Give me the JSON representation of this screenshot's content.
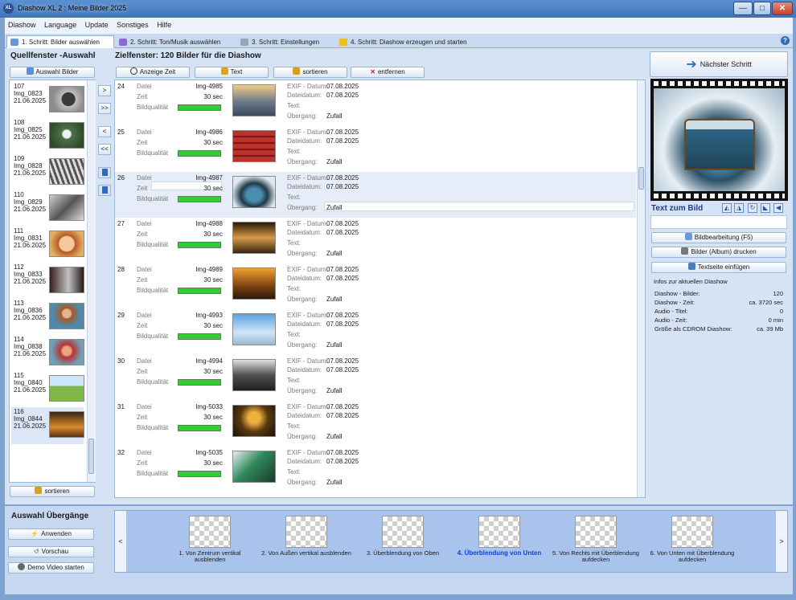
{
  "window": {
    "title": "Diashow XL 2 : Meine Bilder 2025",
    "app_icon": "XL",
    "minimize": "—",
    "maximize": "□",
    "close": "✕"
  },
  "menu": [
    "Diashow",
    "Language",
    "Update",
    "Sonstiges",
    "Hilfe"
  ],
  "tabs": [
    "1. Schritt: Bilder auswählen",
    "2. Schritt: Ton/Musik auswählen",
    "3. Schritt: Einstellungen",
    "4. Schritt: Diashow erzeugen und starten"
  ],
  "help_label": "?",
  "source": {
    "title": "Quellfenster -Auswahl",
    "select_button": "Auswahl Bilder",
    "sort_button": "sortieren",
    "items": [
      {
        "num": "107",
        "name": "Img_0823",
        "date": "21.06.2025"
      },
      {
        "num": "108",
        "name": "Img_0825",
        "date": "21.06.2025"
      },
      {
        "num": "109",
        "name": "Img_0828",
        "date": "21.06.2025"
      },
      {
        "num": "110",
        "name": "Img_0829",
        "date": "21.06.2025"
      },
      {
        "num": "111",
        "name": "Img_0831",
        "date": "21.06.2025"
      },
      {
        "num": "112",
        "name": "Img_0833",
        "date": "21.06.2025"
      },
      {
        "num": "113",
        "name": "Img_0836",
        "date": "21.06.2025"
      },
      {
        "num": "114",
        "name": "Img_0838",
        "date": "21.06.2025"
      },
      {
        "num": "115",
        "name": "Img_0840",
        "date": "21.06.2025"
      },
      {
        "num": "116",
        "name": "Img_0844",
        "date": "21.06.2025"
      }
    ]
  },
  "transfer": {
    "add": ">",
    "add_all": ">>",
    "remove": "<",
    "remove_all": "<<"
  },
  "target": {
    "title": "Zielfenster: 120 Bilder für die Diashow",
    "buttons": {
      "time": "Anzeige Zeit",
      "text": "Text",
      "sort": "sortieren",
      "remove": "entfernen"
    },
    "labels": {
      "file": "Datei",
      "time": "Zeit",
      "quality": "Bildqualität",
      "exif": "EXIF - Datum:",
      "filedate": "Dateidatum:",
      "text": "Text:",
      "transition": "Übergang:"
    },
    "rows": [
      {
        "num": "24",
        "file": "Img-4985",
        "time": "30 sec",
        "exif": "07.08.2025",
        "filedate": "07.08.2025",
        "transition": "Zufall",
        "quality": 1
      },
      {
        "num": "25",
        "file": "Img-4986",
        "time": "30 sec",
        "exif": "07.08.2025",
        "filedate": "07.08.2025",
        "transition": "Zufall",
        "quality": 1
      },
      {
        "num": "26",
        "file": "Img-4987",
        "time": "30 sec",
        "exif": "07.08.2025",
        "filedate": "07.08.2025",
        "transition": "Zufall",
        "quality": 1
      },
      {
        "num": "27",
        "file": "Img-4988",
        "time": "30 sec",
        "exif": "07.08.2025",
        "filedate": "07.08.2025",
        "transition": "Zufall",
        "quality": 1
      },
      {
        "num": "28",
        "file": "Img-4989",
        "time": "30 sec",
        "exif": "07.08.2025",
        "filedate": "07.08.2025",
        "transition": "Zufall",
        "quality": 1
      },
      {
        "num": "29",
        "file": "Img-4993",
        "time": "30 sec",
        "exif": "07.08.2025",
        "filedate": "07.08.2025",
        "transition": "Zufall",
        "quality": 1
      },
      {
        "num": "30",
        "file": "Img-4994",
        "time": "30 sec",
        "exif": "07.08.2025",
        "filedate": "07.08.2025",
        "transition": "Zufall",
        "quality": 1
      },
      {
        "num": "31",
        "file": "Img-5033",
        "time": "30 sec",
        "exif": "07.08.2025",
        "filedate": "07.08.2025",
        "transition": "Zufall",
        "quality": 1
      },
      {
        "num": "32",
        "file": "Img-5035",
        "time": "30 sec",
        "exif": "07.08.2025",
        "filedate": "07.08.2025",
        "transition": "Zufall",
        "quality": 1
      }
    ]
  },
  "right": {
    "next_step": "Nächster Schritt",
    "text_label": "Text zum Bild",
    "edit_button": "Bildbearbeitung (F5)",
    "print_button": "Bilder (Album) drucken",
    "textpage_button": "Textseite einfügen",
    "info_title": "Infos zur aktuellen Diashow",
    "info": [
      {
        "k": "Diashow - Bilder:",
        "v": "120"
      },
      {
        "k": "Diashow - Zeit:",
        "v": "ca. 3720 sec"
      },
      {
        "k": "Audio - Titel:",
        "v": "0"
      },
      {
        "k": "Audio - Zeit:",
        "v": "0 min"
      },
      {
        "k": "Größe als CDROM Diashow:",
        "v": "ca. 39 Mb"
      }
    ]
  },
  "transitions": {
    "title": "Auswahl Übergänge",
    "apply": "Anwenden",
    "preview": "Vorschau",
    "demo": "Demo Video starten",
    "prev": "<",
    "next": ">",
    "items": [
      {
        "label": "1. Von Zentrum vertikal ausblenden",
        "active": false
      },
      {
        "label": "2. Von Außen vertikal ausblenden",
        "active": false
      },
      {
        "label": "3. Überblendung von Oben",
        "active": false
      },
      {
        "label": "4. Überblendung von Unten",
        "active": true
      },
      {
        "label": "5. Von Rechts mit Überblendung aufdecken",
        "active": false
      },
      {
        "label": "6. Von Unten mit Überblendung aufdecken",
        "active": false
      }
    ]
  },
  "colors": {
    "accent": "#1040d8",
    "quality_bar": "#2fcf2f",
    "selection": "#dbe6f6"
  }
}
